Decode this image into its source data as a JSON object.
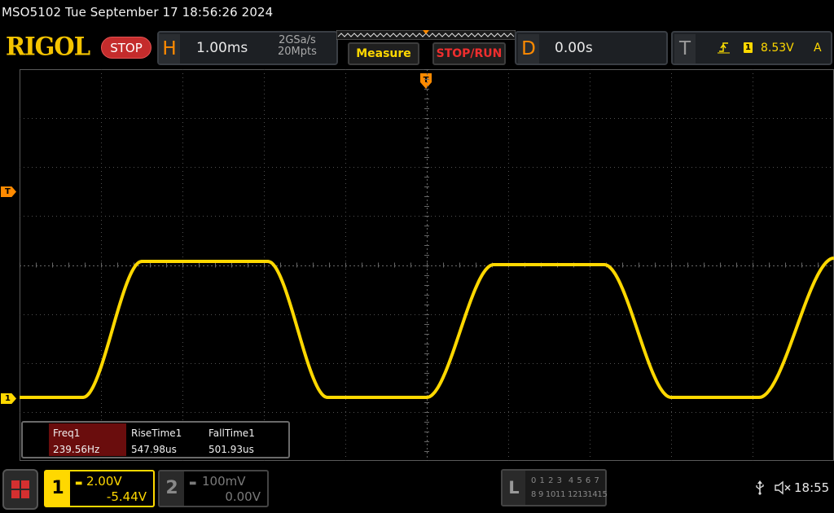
{
  "status_bar": {
    "title": "MSO5102  Tue September 17 18:56:26 2024"
  },
  "brand": {
    "logo": "RIGOL",
    "run_state": "STOP"
  },
  "horizontal": {
    "letter": "H",
    "time_per_div": "1.00ms",
    "sample_rate": "2GSa/s",
    "memory_depth": "20Mpts"
  },
  "buttons": {
    "measure": "Measure",
    "stop_run": "STOP/RUN"
  },
  "delay": {
    "letter": "D",
    "value": "0.00s"
  },
  "trigger": {
    "letter": "T",
    "edge_icon": "rising-edge-icon",
    "source": "1",
    "level": "8.53V",
    "mode": "A"
  },
  "markers": {
    "trigger_level": "T",
    "channel1_ground": "1"
  },
  "measurements": {
    "headers": [
      "Freq1",
      "RiseTime1",
      "FallTime1"
    ],
    "values": [
      "239.56Hz",
      "547.98us",
      "501.93us"
    ]
  },
  "channel1": {
    "number": "1",
    "scale": "2.00V",
    "offset": "-5.44V",
    "color": "#ffd800",
    "coupling_icon": "dc-coupling-icon"
  },
  "channel2": {
    "number": "2",
    "scale": "100mV",
    "offset": "0.00V",
    "coupling_icon": "dc-coupling-icon"
  },
  "logic": {
    "letter": "L",
    "row1": "0 1 2 3  4 5 6 7",
    "row2": "8 9 1011 12131415"
  },
  "system": {
    "usb_icon": "usb-icon",
    "speaker_icon": "speaker-muted-icon",
    "time": "18:55"
  },
  "waveform": {
    "description_units": "screen divisions",
    "color": "#ffd800",
    "high_level_div": 2.7,
    "low_level_div": 0.0
  }
}
